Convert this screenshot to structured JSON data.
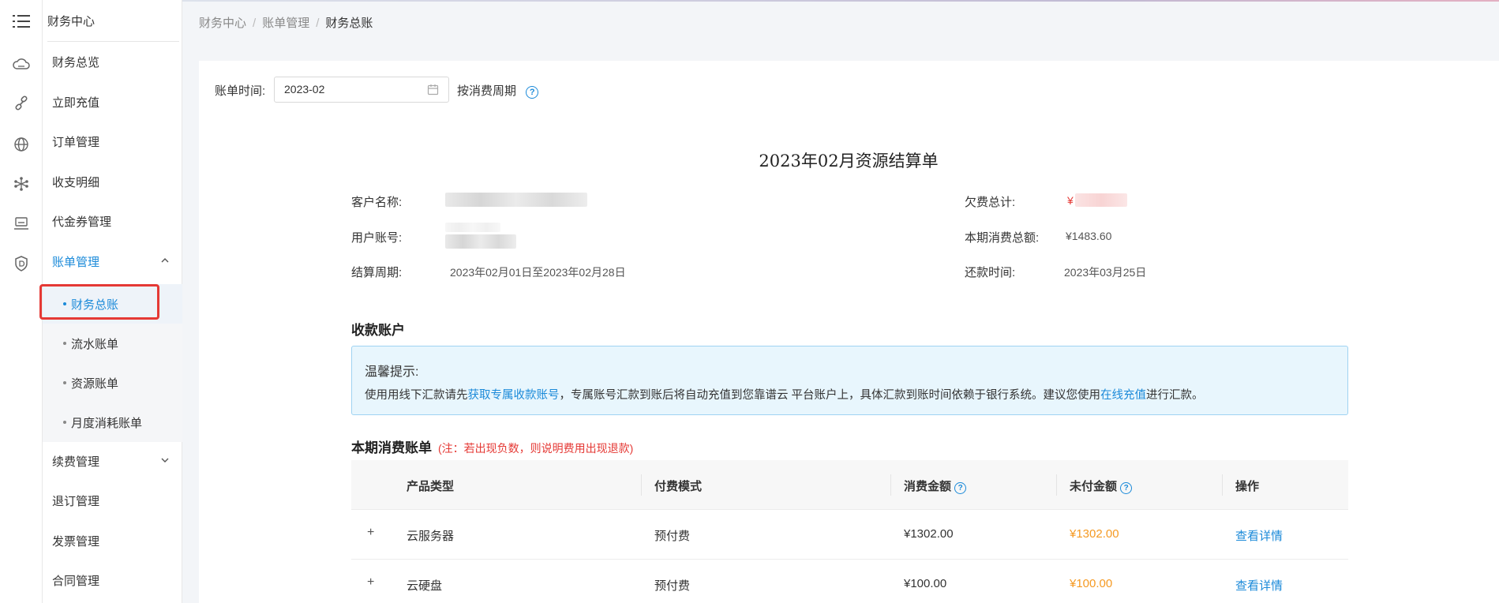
{
  "sidebar": {
    "title": "财务中心",
    "menu": [
      {
        "label": "财务总览"
      },
      {
        "label": "立即充值"
      },
      {
        "label": "订单管理"
      },
      {
        "label": "收支明细"
      },
      {
        "label": "代金券管理"
      },
      {
        "label": "账单管理"
      },
      {
        "label": "续费管理"
      },
      {
        "label": "退订管理"
      },
      {
        "label": "发票管理"
      },
      {
        "label": "合同管理"
      }
    ],
    "submenu": [
      {
        "label": "财务总账"
      },
      {
        "label": "流水账单"
      },
      {
        "label": "资源账单"
      },
      {
        "label": "月度消耗账单"
      }
    ]
  },
  "breadcrumb": {
    "items": [
      "财务中心",
      "账单管理",
      "财务总账"
    ],
    "sep": "/"
  },
  "filter": {
    "label": "账单时间:",
    "date_value": "2023-02",
    "period_label": "按消费周期",
    "help": "?"
  },
  "bill": {
    "title": "2023年02月资源结算单",
    "customer_label": "客户名称:",
    "account_label": "用户账号:",
    "cycle_label": "结算周期:",
    "cycle_value": "2023年02月01日至2023年02月28日",
    "arrears_label": "欠费总计:",
    "arrears_prefix": "¥",
    "total_label": "本期消费总额:",
    "total_value": "¥1483.60",
    "due_label": "还款时间:",
    "due_value": "2023年03月25日"
  },
  "receipt": {
    "title": "收款账户",
    "tip_title": "温馨提示:",
    "tip_text_1": "使用用线下汇款请先",
    "tip_link_1": "获取专属收款账号",
    "tip_text_2": "，专属账号汇款到账后将自动充值到您靠谱云 平台账户上，具体汇款到账时间依赖于银行系统。建议您使用",
    "tip_link_2": "在线充值",
    "tip_text_3": "进行汇款。"
  },
  "consumption": {
    "title": "本期消费账单",
    "note": "(注：若出现负数，则说明费用出现退款)",
    "headers": {
      "type": "产品类型",
      "mode": "付费模式",
      "amount": "消费金额",
      "unpaid": "未付金额",
      "op": "操作"
    },
    "rows": [
      {
        "expand": "+",
        "type": "云服务器",
        "mode": "预付费",
        "amount": "¥1302.00",
        "unpaid": "¥1302.00",
        "op": "查看详情"
      },
      {
        "expand": "+",
        "type": "云硬盘",
        "mode": "预付费",
        "amount": "¥100.00",
        "unpaid": "¥100.00",
        "op": "查看详情"
      }
    ]
  }
}
